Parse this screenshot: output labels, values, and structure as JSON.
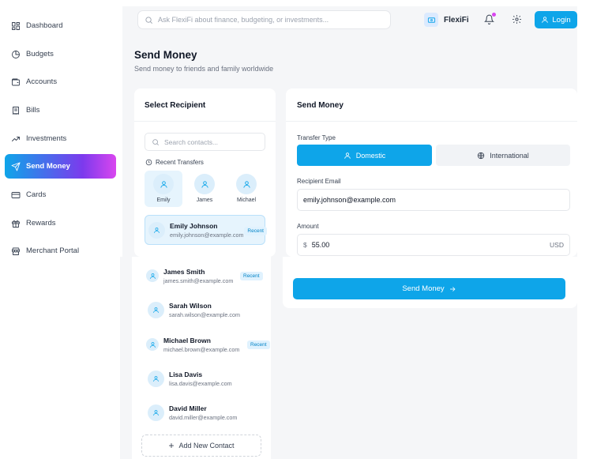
{
  "sidebar": {
    "items": [
      {
        "label": "Dashboard",
        "icon": "dashboard-icon"
      },
      {
        "label": "Budgets",
        "icon": "pie-chart-icon"
      },
      {
        "label": "Accounts",
        "icon": "wallet-icon"
      },
      {
        "label": "Bills",
        "icon": "receipt-icon"
      },
      {
        "label": "Investments",
        "icon": "trending-up-icon"
      },
      {
        "label": "Send Money",
        "icon": "send-icon",
        "active": true
      },
      {
        "label": "Cards",
        "icon": "credit-card-icon"
      },
      {
        "label": "Rewards",
        "icon": "gift-icon"
      },
      {
        "label": "Merchant Portal",
        "icon": "store-icon"
      }
    ]
  },
  "header": {
    "search_placeholder": "Ask FlexiFi about finance, budgeting, or investments...",
    "brand": "FlexiFi",
    "login_label": "Login"
  },
  "page": {
    "title": "Send Money",
    "subtitle": "Send money to friends and family worldwide"
  },
  "recipient": {
    "title": "Select Recipient",
    "search_placeholder": "Search contacts...",
    "recent_label": "Recent Transfers",
    "recent": [
      {
        "name": "Emily",
        "selected": true
      },
      {
        "name": "James",
        "selected": false
      },
      {
        "name": "Michael",
        "selected": false
      }
    ],
    "contacts": [
      {
        "name": "Emily Johnson",
        "email": "emily.johnson@example.com",
        "badge": "Recent",
        "selected": true
      },
      {
        "name": "James Smith",
        "email": "james.smith@example.com",
        "badge": "Recent"
      },
      {
        "name": "Sarah Wilson",
        "email": "sarah.wilson@example.com",
        "badge": ""
      },
      {
        "name": "Michael Brown",
        "email": "michael.brown@example.com",
        "badge": "Recent"
      },
      {
        "name": "Lisa Davis",
        "email": "lisa.davis@example.com",
        "badge": ""
      },
      {
        "name": "David Miller",
        "email": "david.miller@example.com",
        "badge": ""
      }
    ],
    "add_contact_label": "Add New Contact"
  },
  "form": {
    "title": "Send Money",
    "transfer_type_label": "Transfer Type",
    "domestic_label": "Domestic",
    "international_label": "International",
    "email_label": "Recipient Email",
    "email_value": "emily.johnson@example.com",
    "amount_label": "Amount",
    "currency_symbol": "$",
    "amount_value": "55.00",
    "currency_code": "USD",
    "send_label": "Send Money"
  },
  "colors": {
    "accent": "#0ea5e9",
    "gradient_end": "#d946ef",
    "background": "#f5f6f8"
  }
}
